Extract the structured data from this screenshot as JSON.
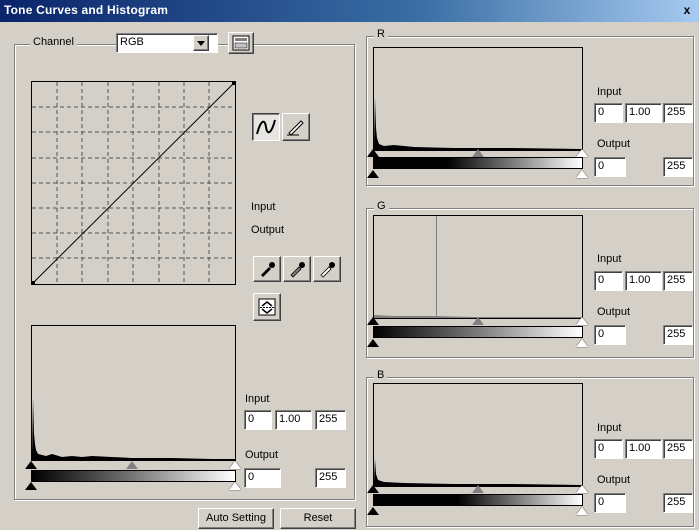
{
  "window": {
    "title": "Tone Curves and Histogram",
    "close_glyph": "x"
  },
  "channel": {
    "label": "Channel",
    "selected": "RGB"
  },
  "main": {
    "input_label": "Input",
    "output_label": "Output",
    "hist": {
      "input_label": "Input",
      "input_low": "0",
      "input_gamma": "1.00",
      "input_high": "255",
      "output_label": "Output",
      "output_low": "0",
      "output_high": "255"
    }
  },
  "channels": [
    {
      "name": "R",
      "input_label": "Input",
      "input_low": "0",
      "input_gamma": "1.00",
      "input_high": "255",
      "output_label": "Output",
      "output_low": "0",
      "output_high": "255"
    },
    {
      "name": "G",
      "input_label": "Input",
      "input_low": "0",
      "input_gamma": "1.00",
      "input_high": "255",
      "output_label": "Output",
      "output_low": "0",
      "output_high": "255"
    },
    {
      "name": "B",
      "input_label": "Input",
      "input_low": "0",
      "input_gamma": "1.00",
      "input_high": "255",
      "output_label": "Output",
      "output_low": "0",
      "output_high": "255"
    }
  ],
  "buttons": {
    "auto_setting": "Auto Setting",
    "reset": "Reset"
  },
  "icons": [
    "curve-mode-icon",
    "freehand-mode-icon",
    "black-point-eyedropper-icon",
    "gray-point-eyedropper-icon",
    "white-point-eyedropper-icon",
    "save-load-icon",
    "channel-preview-icon"
  ]
}
